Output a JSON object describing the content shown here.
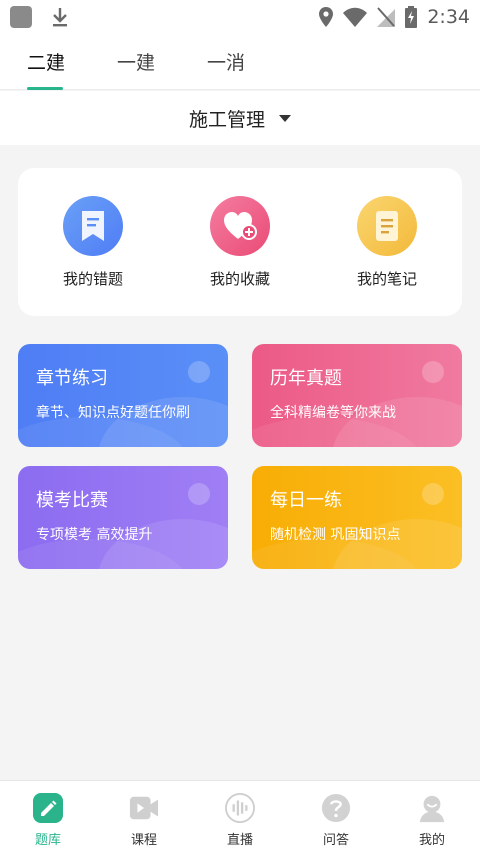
{
  "status_bar": {
    "time": "2:34"
  },
  "tabs": [
    {
      "label": "二建"
    },
    {
      "label": "一建"
    },
    {
      "label": "一消"
    }
  ],
  "subject_selector": {
    "label": "施工管理"
  },
  "quick_actions": [
    {
      "label": "我的错题",
      "icon": "bookmark-list-icon",
      "color": "#5b8ff5"
    },
    {
      "label": "我的收藏",
      "icon": "heart-plus-icon",
      "color": "#ef5b82"
    },
    {
      "label": "我的笔记",
      "icon": "note-icon",
      "color": "#f5c347"
    }
  ],
  "feature_cards": [
    {
      "title": "章节练习",
      "subtitle": "章节、知识点好题任你刷",
      "color": "#4f7df5"
    },
    {
      "title": "历年真题",
      "subtitle": "全科精编卷等你来战",
      "color": "#ec5a86"
    },
    {
      "title": "模考比赛",
      "subtitle": "专项模考 高效提升",
      "color": "#8c6cf0"
    },
    {
      "title": "每日一练",
      "subtitle": "随机检测 巩固知识点",
      "color": "#f8ad05"
    }
  ],
  "bottom_nav": [
    {
      "label": "题库",
      "icon": "pencil-icon",
      "active": true
    },
    {
      "label": "课程",
      "icon": "video-play-icon"
    },
    {
      "label": "直播",
      "icon": "live-audio-icon"
    },
    {
      "label": "问答",
      "icon": "question-icon"
    },
    {
      "label": "我的",
      "icon": "profile-icon"
    }
  ],
  "accent_color": "#28b48c"
}
